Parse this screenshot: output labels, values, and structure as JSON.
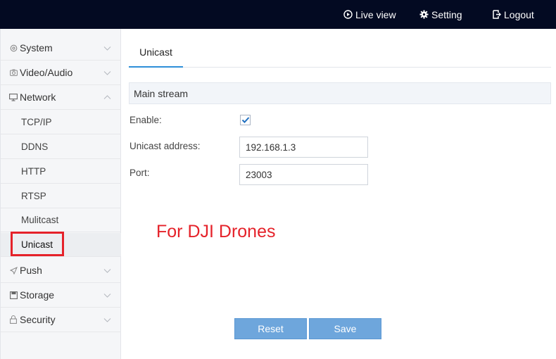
{
  "topbar": {
    "live_view": "Live view",
    "setting": "Setting",
    "logout": "Logout"
  },
  "sidebar": {
    "system": "System",
    "video_audio": "Video/Audio",
    "network": "Network",
    "network_items": [
      "TCP/IP",
      "DDNS",
      "HTTP",
      "RTSP",
      "Mulitcast",
      "Unicast"
    ],
    "push": "Push",
    "storage": "Storage",
    "security": "Security"
  },
  "main": {
    "tab": "Unicast",
    "section": "Main stream",
    "enable_label": "Enable:",
    "enable_checked": true,
    "address_label": "Unicast address:",
    "address_value": "192.168.1.3",
    "port_label": "Port:",
    "port_value": "23003",
    "annotation": "For DJI Drones",
    "reset": "Reset",
    "save": "Save"
  },
  "colors": {
    "topbar": "#030a22",
    "accent": "#2e8fd8",
    "button": "#6ea6dc",
    "highlight": "#e5222a"
  }
}
